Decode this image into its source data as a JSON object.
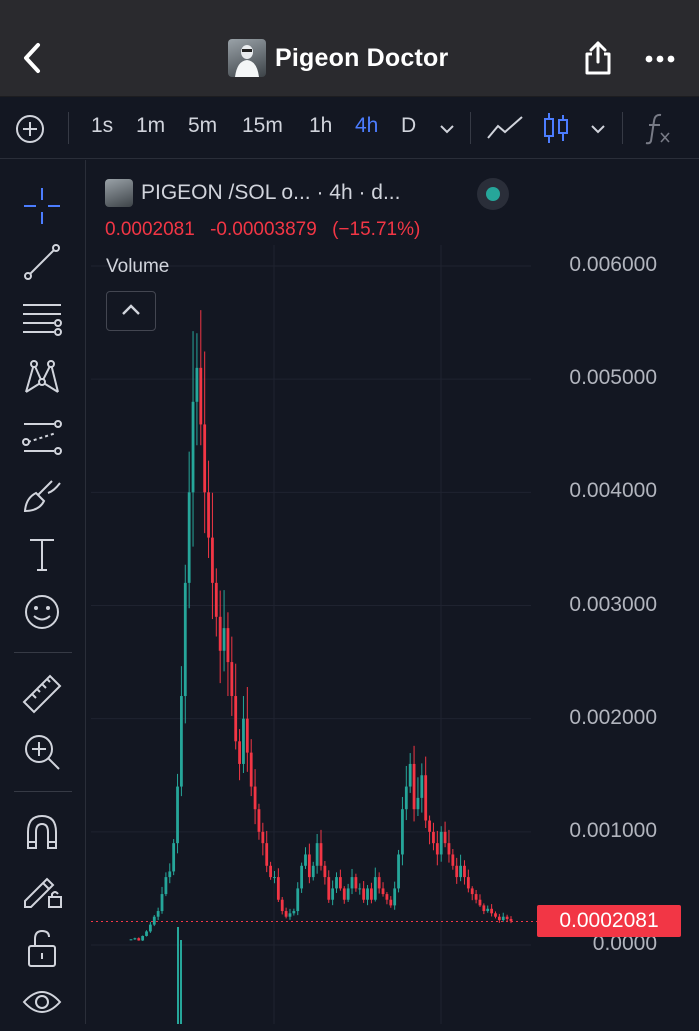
{
  "header": {
    "title": "Pigeon Doctor"
  },
  "toolbar": {
    "intervals": [
      "1s",
      "1m",
      "5m",
      "15m",
      "1h",
      "4h",
      "D"
    ],
    "active_interval": "4h"
  },
  "legend": {
    "title": "PIGEON /SOL o... · 4h · d...",
    "price": "0.0002081",
    "change": "-0.00003879",
    "change_pct": "(−15.71%)",
    "volume_label": "Volume",
    "status_color": "#26a69a"
  },
  "price_axis": {
    "labels": [
      "0.006000",
      "0.005000",
      "0.004000",
      "0.003000",
      "0.002000",
      "0.001000",
      "0.0000"
    ]
  },
  "last_price": {
    "value": "0.0002081",
    "color": "#f23645"
  },
  "colors": {
    "up": "#26a69a",
    "down": "#f23645",
    "accent": "#4c7dff"
  },
  "chart_data": {
    "type": "candlestick",
    "interval": "4h",
    "ylim": [
      0,
      0.006
    ],
    "last": 0.0002081,
    "candles_close": [
      5e-05,
      6e-05,
      4e-05,
      8e-05,
      0.00012,
      0.00018,
      0.00025,
      0.0003,
      0.00045,
      0.0006,
      0.00065,
      0.0009,
      0.0014,
      0.0022,
      0.0032,
      0.004,
      0.0048,
      0.0051,
      0.0046,
      0.004,
      0.0036,
      0.0032,
      0.0029,
      0.0026,
      0.0028,
      0.0025,
      0.0022,
      0.0018,
      0.0016,
      0.002,
      0.0017,
      0.0014,
      0.0012,
      0.001,
      0.0009,
      0.0007,
      0.0006,
      0.0006,
      0.0004,
      0.0003,
      0.00025,
      0.00028,
      0.0003,
      0.0005,
      0.0007,
      0.0008,
      0.0006,
      0.0007,
      0.0009,
      0.0007,
      0.0006,
      0.0004,
      0.0005,
      0.0006,
      0.0005,
      0.0004,
      0.0005,
      0.0006,
      0.0005,
      0.0005,
      0.0004,
      0.0005,
      0.0004,
      0.0006,
      0.0005,
      0.00045,
      0.0004,
      0.00035,
      0.0005,
      0.0008,
      0.0012,
      0.0014,
      0.0016,
      0.0012,
      0.0013,
      0.0015,
      0.0011,
      0.001,
      0.0009,
      0.0008,
      0.001,
      0.0009,
      0.0008,
      0.0007,
      0.0006,
      0.0007,
      0.0006,
      0.0005,
      0.00045,
      0.0004,
      0.00035,
      0.0003,
      0.00032,
      0.00028,
      0.00025,
      0.00022,
      0.00025,
      0.00023,
      0.00021
    ]
  }
}
